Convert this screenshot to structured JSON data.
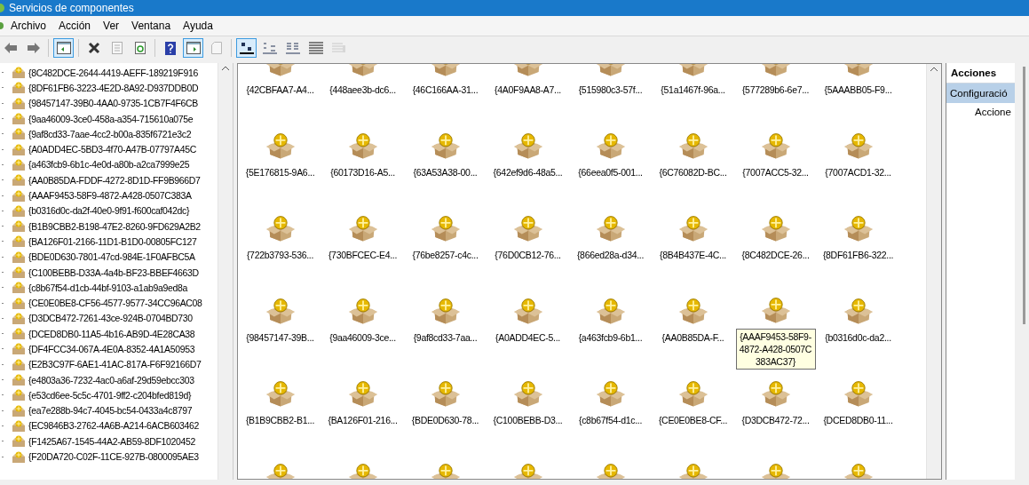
{
  "window": {
    "title": "Servicios de componentes"
  },
  "menu": [
    "Archivo",
    "Acción",
    "Ver",
    "Ventana",
    "Ayuda"
  ],
  "toolbar": [
    {
      "kind": "back",
      "pressed": false,
      "disabled": false
    },
    {
      "kind": "forward",
      "pressed": false,
      "disabled": false
    },
    {
      "kind": "sep"
    },
    {
      "kind": "tree",
      "pressed": true,
      "disabled": false
    },
    {
      "kind": "sep"
    },
    {
      "kind": "delete",
      "pressed": false,
      "disabled": false
    },
    {
      "kind": "properties",
      "pressed": false,
      "disabled": true
    },
    {
      "kind": "refresh",
      "pressed": false,
      "disabled": false
    },
    {
      "kind": "sep"
    },
    {
      "kind": "help",
      "pressed": false,
      "disabled": false
    },
    {
      "kind": "actionpane",
      "pressed": true,
      "disabled": false
    },
    {
      "kind": "export",
      "pressed": false,
      "disabled": true
    },
    {
      "kind": "sep"
    },
    {
      "kind": "largeicons",
      "pressed": true,
      "disabled": false
    },
    {
      "kind": "smallicons",
      "pressed": false,
      "disabled": false
    },
    {
      "kind": "list",
      "pressed": false,
      "disabled": false
    },
    {
      "kind": "details",
      "pressed": false,
      "disabled": false
    },
    {
      "kind": "custom",
      "pressed": false,
      "disabled": true
    }
  ],
  "tree": {
    "items": [
      "{8C482DCE-2644-4419-AEFF-189219F916",
      "{8DF61FB6-3223-4E2D-8A92-D937DDB0D",
      "{98457147-39B0-4AA0-9735-1CB7F4F6CB",
      "{9aa46009-3ce0-458a-a354-715610a075e",
      "{9af8cd33-7aae-4cc2-b00a-835f6721e3c2",
      "{A0ADD4EC-5BD3-4f70-A47B-07797A45C",
      "{a463fcb9-6b1c-4e0d-a80b-a2ca7999e25",
      "{AA0B85DA-FDDF-4272-8D1D-FF9B966D7",
      "{AAAF9453-58F9-4872-A428-0507C383A",
      "{b0316d0c-da2f-40e0-9f91-f600caf042dc}",
      "{B1B9CBB2-B198-47E2-8260-9FD629A2B2",
      "{BA126F01-2166-11D1-B1D0-00805FC127",
      "{BDE0D630-7801-47cd-984E-1F0AFBC5A",
      "{C100BEBB-D33A-4a4b-BF23-BBEF4663D",
      "{c8b67f54-d1cb-44bf-9103-a1ab9a9ed8a",
      "{CE0E0BE8-CF56-4577-9577-34CC96AC08",
      "{D3DCB472-7261-43ce-924B-0704BD730",
      "{DCED8DB0-11A5-4b16-AB9D-4E28CA38",
      "{DF4FCC34-067A-4E0A-8352-4A1A50953",
      "{E2B3C97F-6AE1-41AC-817A-F6F92166D7",
      "{e4803a36-7232-4ac0-a6af-29d59ebcc303",
      "{e53cd6ee-5c5c-4701-9ff2-c204bfed819d}",
      "{ea7e288b-94c7-4045-bc54-0433a4c8797",
      "{EC9846B3-2762-4A6B-A214-6ACB603462",
      "{F1425A67-1545-44A2-AB59-8DF1020452",
      "{F20DA720-C02F-11CE-927B-0800095AE3"
    ]
  },
  "grid": {
    "items": [
      {
        "label": "{42CBFAA7-A4...",
        "selected": false
      },
      {
        "label": "{448aee3b-dc6...",
        "selected": false
      },
      {
        "label": "{46C166AA-31...",
        "selected": false
      },
      {
        "label": "{4A0F9AA8-A7...",
        "selected": false
      },
      {
        "label": "{515980c3-57f...",
        "selected": false
      },
      {
        "label": "{51a1467f-96a...",
        "selected": false
      },
      {
        "label": "{577289b6-6e7...",
        "selected": false
      },
      {
        "label": "{5AAABB05-F9...",
        "selected": false
      },
      {
        "label": "{5E176815-9A6...",
        "selected": false
      },
      {
        "label": "{60173D16-A5...",
        "selected": false
      },
      {
        "label": "{63A53A38-00...",
        "selected": false
      },
      {
        "label": "{642ef9d6-48a5...",
        "selected": false
      },
      {
        "label": "{66eea0f5-001...",
        "selected": false
      },
      {
        "label": "{6C76082D-BC...",
        "selected": false
      },
      {
        "label": "{7007ACC5-32...",
        "selected": false
      },
      {
        "label": "{7007ACD1-32...",
        "selected": false
      },
      {
        "label": "{722b3793-536...",
        "selected": false
      },
      {
        "label": "{730BFCEC-E4...",
        "selected": false
      },
      {
        "label": "{76be8257-c4c...",
        "selected": false
      },
      {
        "label": "{76D0CB12-76...",
        "selected": false
      },
      {
        "label": "{866ed28a-d34...",
        "selected": false
      },
      {
        "label": "{8B4B437E-4C...",
        "selected": false
      },
      {
        "label": "{8C482DCE-26...",
        "selected": false
      },
      {
        "label": "{8DF61FB6-322...",
        "selected": false
      },
      {
        "label": "{98457147-39B...",
        "selected": false
      },
      {
        "label": "{9aa46009-3ce...",
        "selected": false
      },
      {
        "label": "{9af8cd33-7aa...",
        "selected": false
      },
      {
        "label": "{A0ADD4EC-5...",
        "selected": false
      },
      {
        "label": "{a463fcb9-6b1...",
        "selected": false
      },
      {
        "label": "{AA0B85DA-F...",
        "selected": false
      },
      {
        "label": "{AAAF9453-58F9-4872-A428-0507C383AC37}",
        "selected": true
      },
      {
        "label": "{b0316d0c-da2...",
        "selected": false
      },
      {
        "label": "{B1B9CBB2-B1...",
        "selected": false
      },
      {
        "label": "{BA126F01-216...",
        "selected": false
      },
      {
        "label": "{BDE0D630-78...",
        "selected": false
      },
      {
        "label": "{C100BEBB-D3...",
        "selected": false
      },
      {
        "label": "{c8b67f54-d1c...",
        "selected": false
      },
      {
        "label": "{CE0E0BE8-CF...",
        "selected": false
      },
      {
        "label": "{D3DCB472-72...",
        "selected": false
      },
      {
        "label": "{DCED8DB0-11...",
        "selected": false
      },
      {
        "selected": false
      },
      {
        "selected": false
      },
      {
        "selected": false
      },
      {
        "selected": false
      },
      {
        "selected": false
      },
      {
        "selected": false
      },
      {
        "selected": false
      },
      {
        "selected": false
      }
    ]
  },
  "actions": {
    "title": "Acciones",
    "section": {
      "label": "Configuració",
      "selected": true
    },
    "items": [
      "Accione"
    ]
  }
}
